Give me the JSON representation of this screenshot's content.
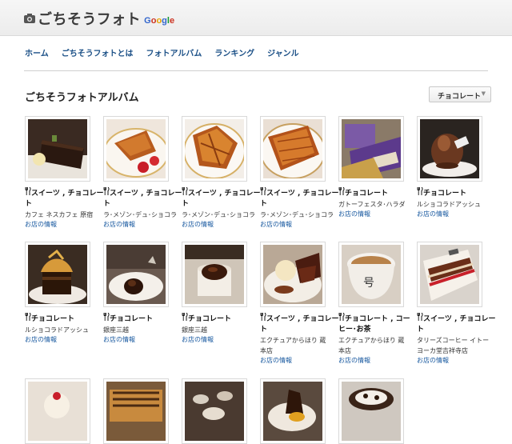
{
  "header": {
    "brand": "ごちそうフォト",
    "google_letters": [
      "G",
      "o",
      "o",
      "g",
      "l",
      "e"
    ]
  },
  "nav": {
    "items": [
      "ホーム",
      "ごちそうフォトとは",
      "フォトアルバム",
      "ランキング",
      "ジャンル"
    ]
  },
  "page": {
    "title": "ごちそうフォトアルバム"
  },
  "filter": {
    "selected": "チョコレート",
    "arrow": "▼"
  },
  "info_label": "お店の情報",
  "photos": [
    {
      "cat1": "スイーツ , チョコレー",
      "cat2": "ト",
      "shop1": "カフェ ネスカフェ 原宿",
      "shop2": ""
    },
    {
      "cat1": "スイーツ , チョコレー",
      "cat2": "ト",
      "shop1": "ラ･メゾン･デュ･ショコラ",
      "shop2": ""
    },
    {
      "cat1": "スイーツ , チョコレー",
      "cat2": "ト",
      "shop1": "ラ･メゾン･デュ･ショコラ",
      "shop2": ""
    },
    {
      "cat1": "スイーツ , チョコレー",
      "cat2": "ト",
      "shop1": "ラ･メゾン･デュ･ショコラ",
      "shop2": ""
    },
    {
      "cat1": "チョコレート",
      "cat2": "",
      "shop1": "ガトーフェスタ･ハラダ",
      "shop2": ""
    },
    {
      "cat1": "チョコレート",
      "cat2": "",
      "shop1": "ルショコラドアッシュ",
      "shop2": ""
    },
    {
      "cat1": "チョコレート",
      "cat2": "",
      "shop1": "ルショコラドアッシュ",
      "shop2": ""
    },
    {
      "cat1": "チョコレート",
      "cat2": "",
      "shop1": "銀座三越",
      "shop2": ""
    },
    {
      "cat1": "チョコレート",
      "cat2": "",
      "shop1": "銀座三越",
      "shop2": ""
    },
    {
      "cat1": "スイーツ , チョコレー",
      "cat2": "ト",
      "shop1": "エクチュアからほり 蔵",
      "shop2": "本店"
    },
    {
      "cat1": "チョコレート , コー",
      "cat2": "ヒー･お茶",
      "shop1": "エクチュアからほり 蔵",
      "shop2": "本店"
    },
    {
      "cat1": "スイーツ , チョコレー",
      "cat2": "ト",
      "shop1": "タリーズコーヒー イトー",
      "shop2": "ヨーカ堂吉祥寺店"
    }
  ],
  "bottom_photos": [
    "cake",
    "eclair",
    "dining",
    "truffle",
    "parfait"
  ],
  "icons": {
    "camera": "camera-icon",
    "fork_knife": "fork-knife-icon"
  }
}
